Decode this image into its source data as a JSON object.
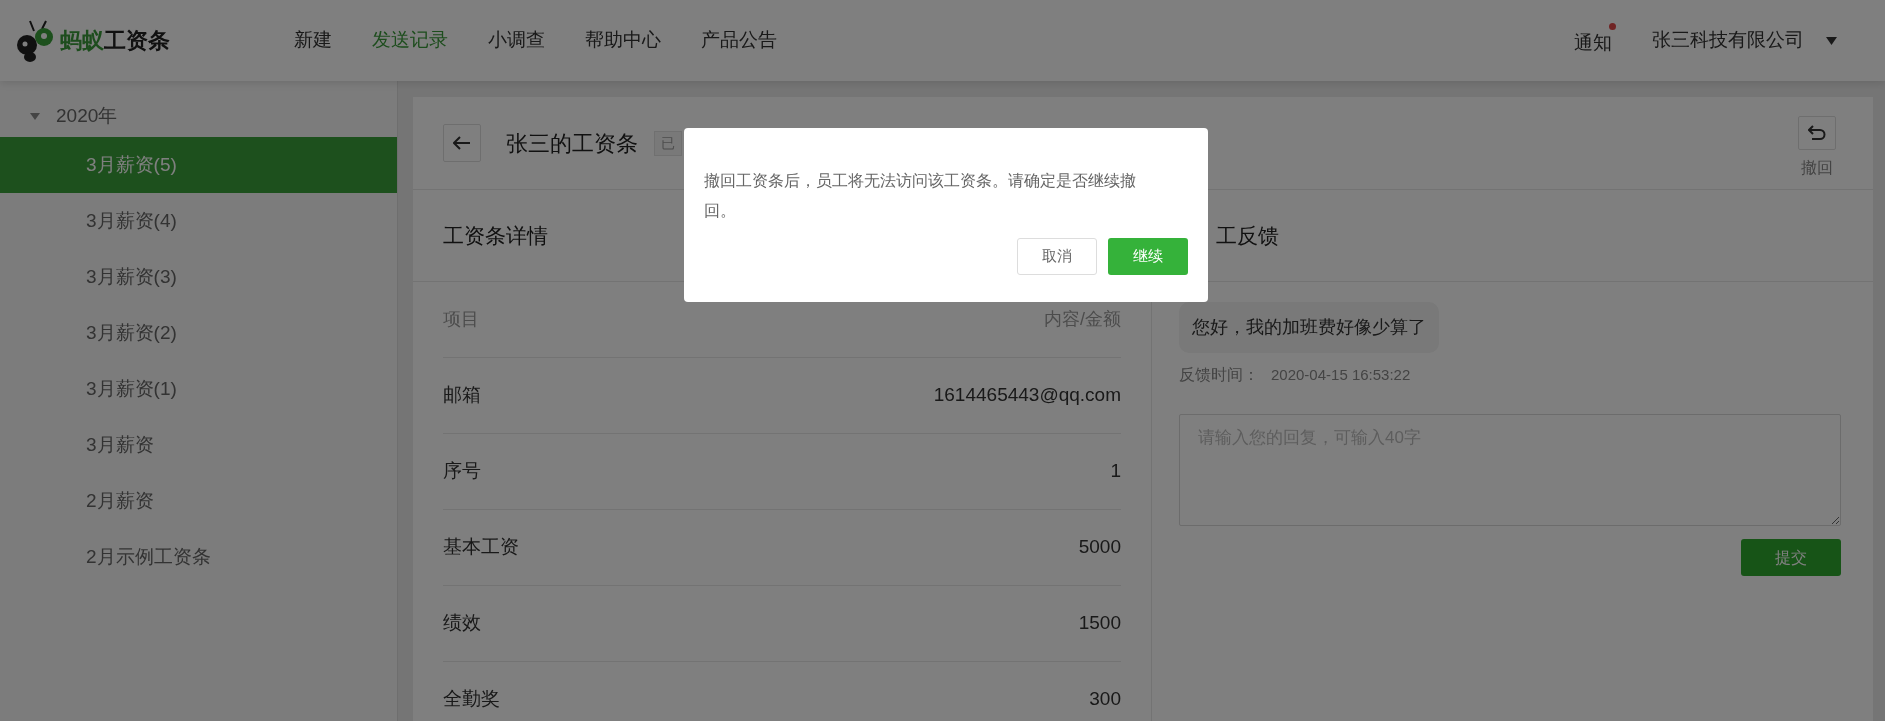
{
  "header": {
    "logo": {
      "brand_green": "蚂蚁",
      "brand_dark": "工资条"
    },
    "nav": [
      {
        "label": "新建",
        "selected": false
      },
      {
        "label": "发送记录",
        "selected": true
      },
      {
        "label": "小调查",
        "selected": false
      },
      {
        "label": "帮助中心",
        "selected": false
      },
      {
        "label": "产品公告",
        "selected": false
      }
    ],
    "notification": {
      "label": "通知",
      "unread": true
    },
    "company": "张三科技有限公司"
  },
  "sidebar": {
    "groups": [
      {
        "label": "2020年",
        "expanded": true,
        "children": [
          {
            "label": "3月薪资(5)",
            "selected": true
          },
          {
            "label": "3月薪资(4)",
            "selected": false
          },
          {
            "label": "3月薪资(3)",
            "selected": false
          },
          {
            "label": "3月薪资(2)",
            "selected": false
          },
          {
            "label": "3月薪资(1)",
            "selected": false
          },
          {
            "label": "3月薪资",
            "selected": false
          },
          {
            "label": "2月薪资",
            "selected": false
          },
          {
            "label": "2月示例工资条",
            "selected": false
          }
        ]
      }
    ]
  },
  "payslip": {
    "title": "张三的工资条",
    "status_badge": "已",
    "revoke_label": "撤回"
  },
  "details": {
    "title": "工资条详情",
    "columns": [
      "项目",
      "内容/金额"
    ],
    "rows": [
      {
        "item": "邮箱",
        "value": "1614465443@qq.com"
      },
      {
        "item": "序号",
        "value": "1"
      },
      {
        "item": "基本工资",
        "value": "5000"
      },
      {
        "item": "绩效",
        "value": "1500"
      },
      {
        "item": "全勤奖",
        "value": "300"
      }
    ]
  },
  "feedback": {
    "title": "工反馈",
    "messages": [
      {
        "text": "您好，我的加班费好像少算了",
        "time_label": "反馈时间：",
        "time": "2020-04-15 16:53:22"
      }
    ],
    "reply": {
      "placeholder": "请输入您的回复，可输入40字"
    },
    "submit": "提交"
  },
  "dialog": {
    "message": "撤回工资条后，员工将无法访问该工资条。请确定是否继续撤回。",
    "buttons": [
      {
        "label": "取消",
        "kind": "secondary"
      },
      {
        "label": "继续",
        "kind": "primary"
      }
    ]
  }
}
